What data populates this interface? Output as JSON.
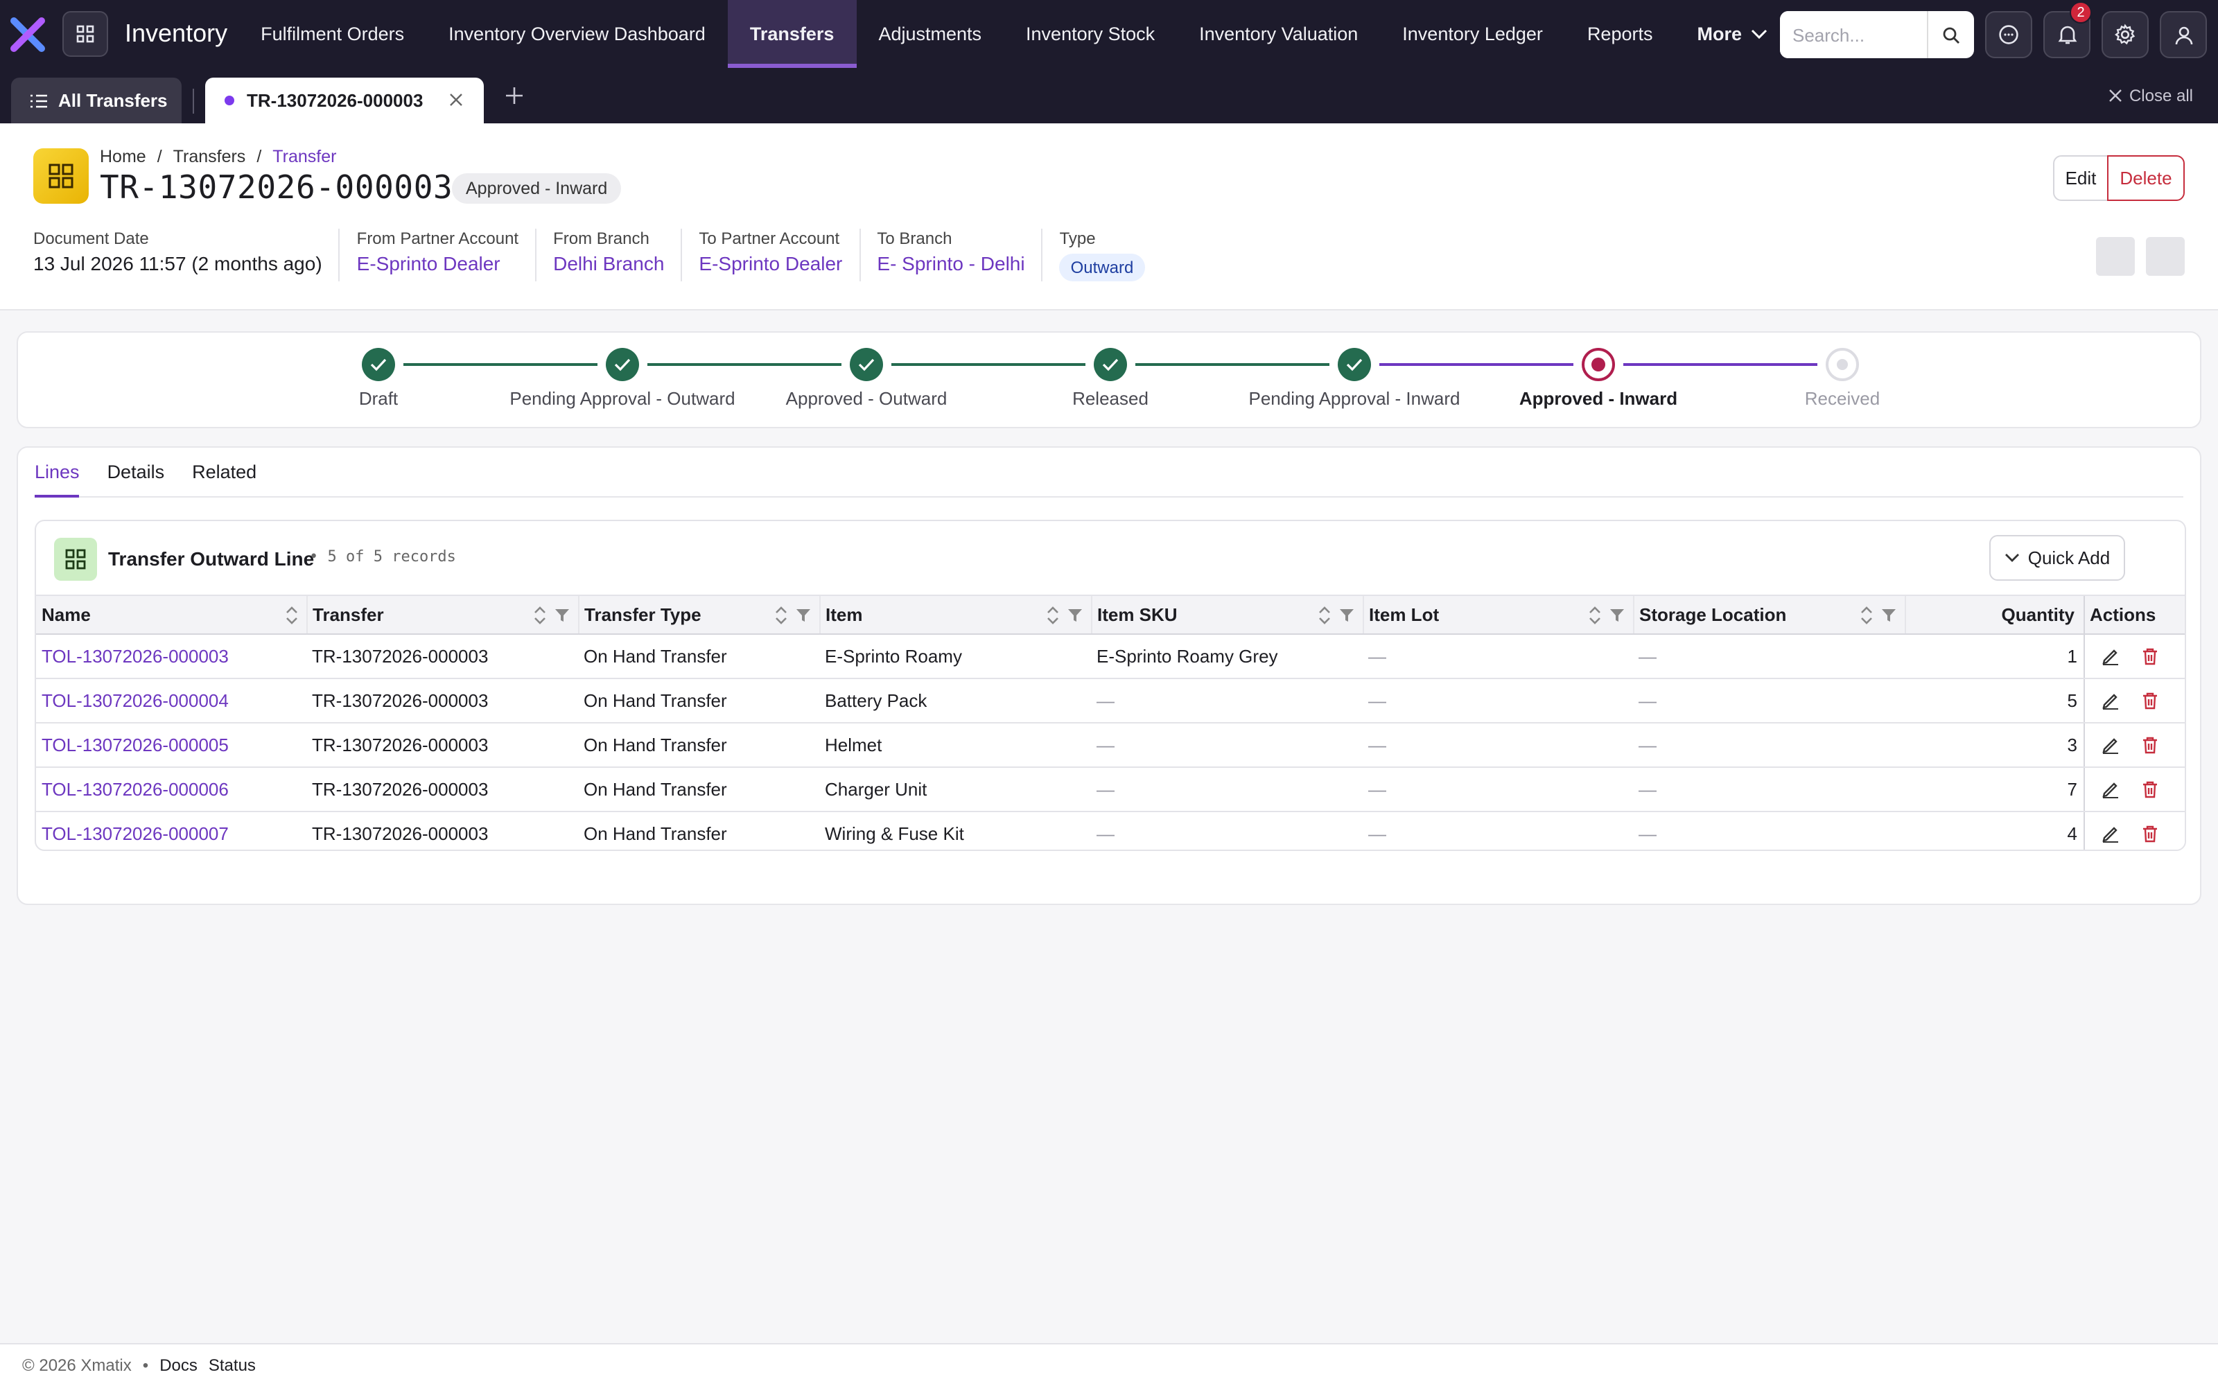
{
  "app": {
    "title": "Inventory"
  },
  "nav": {
    "items": [
      "Fulfilment Orders",
      "Inventory Overview Dashboard",
      "Transfers",
      "Adjustments",
      "Inventory Stock",
      "Inventory Valuation",
      "Inventory Ledger",
      "Reports"
    ],
    "active": "Transfers",
    "more_label": "More"
  },
  "search": {
    "placeholder": "Search..."
  },
  "notifications": {
    "count": "2"
  },
  "tabs": {
    "all_label": "All Transfers",
    "doc_label": "TR-13072026-000003",
    "close_all": "Close all"
  },
  "header": {
    "breadcrumb": [
      "Home",
      "Transfers",
      "Transfer"
    ],
    "breadcrumb_sep": "/",
    "title": "TR-13072026-000003",
    "status": "Approved - Inward",
    "edit_label": "Edit",
    "delete_label": "Delete",
    "fields": {
      "document_date": {
        "label": "Document Date",
        "value": "13 Jul 2026 11:57 (2 months ago)"
      },
      "from_partner": {
        "label": "From Partner Account",
        "value": "E-Sprinto Dealer"
      },
      "from_branch": {
        "label": "From Branch",
        "value": "Delhi Branch"
      },
      "to_partner": {
        "label": "To Partner Account",
        "value": "E-Sprinto Dealer"
      },
      "to_branch": {
        "label": "To Branch",
        "value": "E- Sprinto - Delhi"
      },
      "type": {
        "label": "Type",
        "value": "Outward"
      }
    }
  },
  "stepper": {
    "steps": [
      {
        "label": "Draft",
        "state": "done"
      },
      {
        "label": "Pending Approval - Outward",
        "state": "done"
      },
      {
        "label": "Approved - Outward",
        "state": "done"
      },
      {
        "label": "Released",
        "state": "done"
      },
      {
        "label": "Pending Approval - Inward",
        "state": "done"
      },
      {
        "label": "Approved - Inward",
        "state": "current"
      },
      {
        "label": "Received",
        "state": "pending"
      }
    ],
    "colors": {
      "done": "#246b4f",
      "current": "#b01e4e",
      "pending": "#dcdce2"
    }
  },
  "subtabs": {
    "items": [
      "Lines",
      "Details",
      "Related"
    ],
    "active": "Lines"
  },
  "lines": {
    "title": "Transfer Outward Line",
    "count": "• 5 of 5 records",
    "quick_add": "Quick Add",
    "columns": [
      "Name",
      "Transfer",
      "Transfer Type",
      "Item",
      "Item SKU",
      "Item Lot",
      "Storage Location",
      "Quantity",
      "Actions"
    ],
    "rows": [
      {
        "name": "TOL-13072026-000003",
        "transfer": "TR-13072026-000003",
        "type": "On Hand Transfer",
        "item": "E-Sprinto Roamy",
        "sku": "E-Sprinto Roamy Grey",
        "lot": "—",
        "location": "—",
        "qty": "1"
      },
      {
        "name": "TOL-13072026-000004",
        "transfer": "TR-13072026-000003",
        "type": "On Hand Transfer",
        "item": "Battery Pack",
        "sku": "—",
        "lot": "—",
        "location": "—",
        "qty": "5"
      },
      {
        "name": "TOL-13072026-000005",
        "transfer": "TR-13072026-000003",
        "type": "On Hand Transfer",
        "item": "Helmet",
        "sku": "—",
        "lot": "—",
        "location": "—",
        "qty": "3"
      },
      {
        "name": "TOL-13072026-000006",
        "transfer": "TR-13072026-000003",
        "type": "On Hand Transfer",
        "item": "Charger Unit",
        "sku": "—",
        "lot": "—",
        "location": "—",
        "qty": "7"
      },
      {
        "name": "TOL-13072026-000007",
        "transfer": "TR-13072026-000003",
        "type": "On Hand Transfer",
        "item": "Wiring & Fuse Kit",
        "sku": "—",
        "lot": "—",
        "location": "—",
        "qty": "4"
      }
    ]
  },
  "footer": {
    "copyright": "© 2026 Xmatix",
    "bullet": "•",
    "links": [
      "Docs",
      "Status"
    ]
  },
  "colors": {
    "accent": "#6d37c0",
    "topbar": "#1d1b2c",
    "danger": "#c62d3d"
  }
}
